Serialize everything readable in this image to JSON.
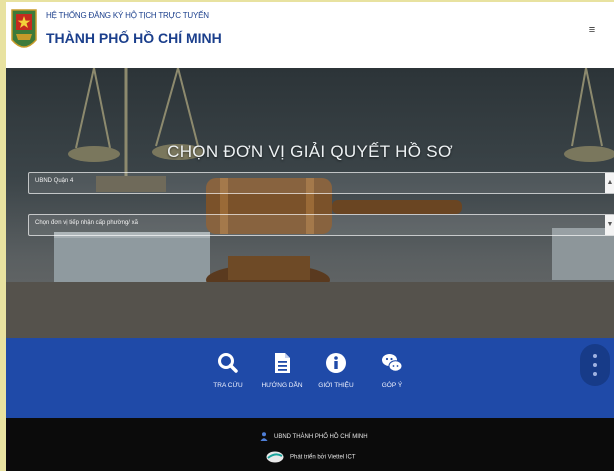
{
  "header": {
    "system_title": "HỆ THỐNG ĐĂNG KÝ HỘ TỊCH TRỰC TUYẾN",
    "city_title": "THÀNH PHỐ HỒ CHÍ MINH",
    "menu_icon": "≡"
  },
  "hero": {
    "title": "CHỌN ĐƠN VỊ GIẢI QUYẾT HỒ SƠ",
    "district_select": {
      "value": "UBND Quận 4"
    },
    "ward_select": {
      "placeholder": "Chọn đơn vị tiếp nhận cấp phường/ xã"
    }
  },
  "nav": {
    "items": [
      {
        "label": "TRA CỨU",
        "icon": "search-icon"
      },
      {
        "label": "HƯỚNG DẪN",
        "icon": "document-icon"
      },
      {
        "label": "GIỚI THIỆU",
        "icon": "info-icon"
      },
      {
        "label": "GÓP Ý",
        "icon": "chat-icon"
      }
    ]
  },
  "footer": {
    "owner": "UBND THÀNH PHỐ HỒ CHÍ MINH",
    "developer": "Phát triển bởi Viettel ICT"
  },
  "colors": {
    "brand_blue": "#1f4aa8",
    "footer_bg": "#0b0b0b",
    "title_blue": "#1b3f8c"
  }
}
